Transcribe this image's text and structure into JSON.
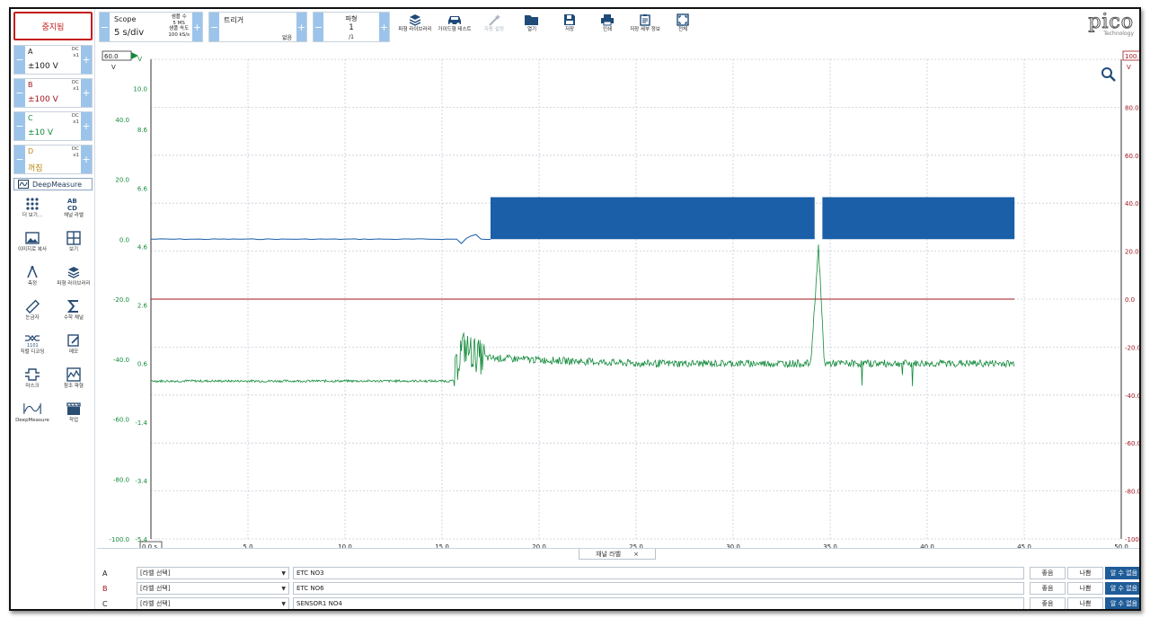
{
  "left": {
    "stop_label": "중지됨",
    "channels": [
      {
        "label": "A",
        "coupling": "DC",
        "probe": "x1",
        "range": "±100 V",
        "color": "#1a1a1a"
      },
      {
        "label": "B",
        "coupling": "DC",
        "probe": "x1",
        "range": "±100 V",
        "color": "#a0141e"
      },
      {
        "label": "C",
        "coupling": "DC",
        "probe": "x1",
        "range": "±10 V",
        "color": "#128a3a"
      },
      {
        "label": "D",
        "coupling": "DC",
        "probe": "x1",
        "range": "꺼짐",
        "color": "#b8860b"
      }
    ],
    "deepmeasure_label": "DeepMeasure",
    "tools": [
      {
        "label": "더 보기...",
        "icon": "dots-grid-icon"
      },
      {
        "label": "채널 라벨",
        "icon": "abcd-icon"
      },
      {
        "label": "이미지로 복사",
        "icon": "image-icon"
      },
      {
        "label": "보기",
        "icon": "grid-icon"
      },
      {
        "label": "측정",
        "icon": "compass-icon"
      },
      {
        "label": "파형 라이브러리",
        "icon": "library-icon"
      },
      {
        "label": "눈금자",
        "icon": "ruler-icon"
      },
      {
        "label": "수학 채널",
        "icon": "sigma-icon"
      },
      {
        "label": "직렬 디코딩",
        "icon": "decode-icon"
      },
      {
        "label": "메모",
        "icon": "note-icon"
      },
      {
        "label": "마스크",
        "icon": "mask-icon"
      },
      {
        "label": "참조 파형",
        "icon": "reference-icon"
      },
      {
        "label": "DeepMeasure",
        "icon": "deepmeasure-icon"
      },
      {
        "label": "작업",
        "icon": "clapper-icon"
      }
    ]
  },
  "toolbar": {
    "scope_label": "Scope",
    "timebase": "5 s/div",
    "samples_label": "샘플 수",
    "samples_value": "5 MS",
    "rate_label": "샘플 속도",
    "rate_value": "100 kS/s",
    "trigger_label": "트리거",
    "trigger_value": "없음",
    "waveform_label": "파형",
    "waveform_value": "1",
    "waveform_total": "/1",
    "buttons": [
      {
        "label": "파형 라이브러리",
        "icon": "library-icon",
        "enabled": true
      },
      {
        "label": "가이드형 테스트",
        "icon": "car-icon",
        "enabled": true
      },
      {
        "label": "자동 설정",
        "icon": "wand-icon",
        "enabled": false
      },
      {
        "label": "열기",
        "icon": "folder-icon",
        "enabled": true
      },
      {
        "label": "저장",
        "icon": "save-icon",
        "enabled": true
      },
      {
        "label": "인쇄",
        "icon": "print-icon",
        "enabled": true
      },
      {
        "label": "저장 세부 정보",
        "icon": "clipboard-icon",
        "enabled": true
      },
      {
        "label": "전체",
        "icon": "fullscreen-icon",
        "enabled": true
      }
    ],
    "logo_text": "pico",
    "logo_sub": "Technology"
  },
  "plot": {
    "left_axis_top": "60.0",
    "left_axis_unit": "V",
    "right_axis_top": "100.0",
    "right_axis_unit": "V",
    "inner_axis_unit": "V",
    "axis_a_labels": [
      "40.0",
      "20.0",
      "0.0",
      "-20.0",
      "-40.0",
      "-60.0",
      "-80.0",
      "-100.0"
    ],
    "axis_c_labels": [
      "10.0",
      "8.6",
      "6.6",
      "4.6",
      "2.6",
      "0.6",
      "-1.4",
      "-3.4",
      "-5.4"
    ],
    "axis_b_labels": [
      "80.0",
      "60.0",
      "40.0",
      "20.0",
      "0.0",
      "-20.0",
      "-40.0",
      "-60.0",
      "-80.0",
      "-100.0"
    ],
    "x_labels": [
      "5.0",
      "10.0",
      "15.0",
      "20.0",
      "25.0",
      "30.0",
      "35.0",
      "40.0",
      "45.0",
      "50.0"
    ],
    "x_start": "0.0 s",
    "colors": {
      "a": "#1a5fa8",
      "b": "#a0141e",
      "c": "#128a3a",
      "grid": "#c5ced8"
    }
  },
  "labels_panel": {
    "tab_title": "채널 라벨",
    "tab_close": "×",
    "select_placeholder": "[라벨 선택]",
    "btn_good": "좋음",
    "btn_bad": "나쁨",
    "btn_unknown": "알 수 없음",
    "rows": [
      {
        "ch": "A",
        "name": "ETC NO3",
        "color": "#1a1a1a"
      },
      {
        "ch": "B",
        "name": "ETC NO6",
        "color": "#a0141e"
      },
      {
        "ch": "C",
        "name": "SENSOR1 NO4",
        "color": "#1a1a1a"
      }
    ]
  },
  "chart_data": {
    "type": "line",
    "x_range": [
      0,
      50
    ],
    "x_unit": "s",
    "series": [
      {
        "name": "A",
        "ylim": [
          -100,
          60
        ],
        "unit": "V",
        "segments": [
          {
            "x": [
              0,
              17.5
            ],
            "y_base": 0,
            "note_peak": 12
          },
          {
            "x": [
              17.5,
              34.2
            ],
            "y_low": 0,
            "y_high": 14
          },
          {
            "x": [
              34.6,
              44.5
            ],
            "y_low": 0,
            "y_high": 14
          }
        ]
      },
      {
        "name": "B",
        "ylim": [
          -100,
          100
        ],
        "unit": "V",
        "value": 0,
        "x": [
          0,
          44.5
        ]
      },
      {
        "name": "C",
        "ylim": [
          -5.4,
          11.0
        ],
        "unit": "V",
        "points": [
          [
            0,
            0.0
          ],
          [
            15.6,
            0.0
          ],
          [
            16.0,
            1.2
          ],
          [
            17.0,
            0.8
          ],
          [
            25,
            0.6
          ],
          [
            34.0,
            0.6
          ],
          [
            34.4,
            4.6
          ],
          [
            34.7,
            0.6
          ],
          [
            44.5,
            0.6
          ]
        ]
      }
    ],
    "grid": true
  }
}
